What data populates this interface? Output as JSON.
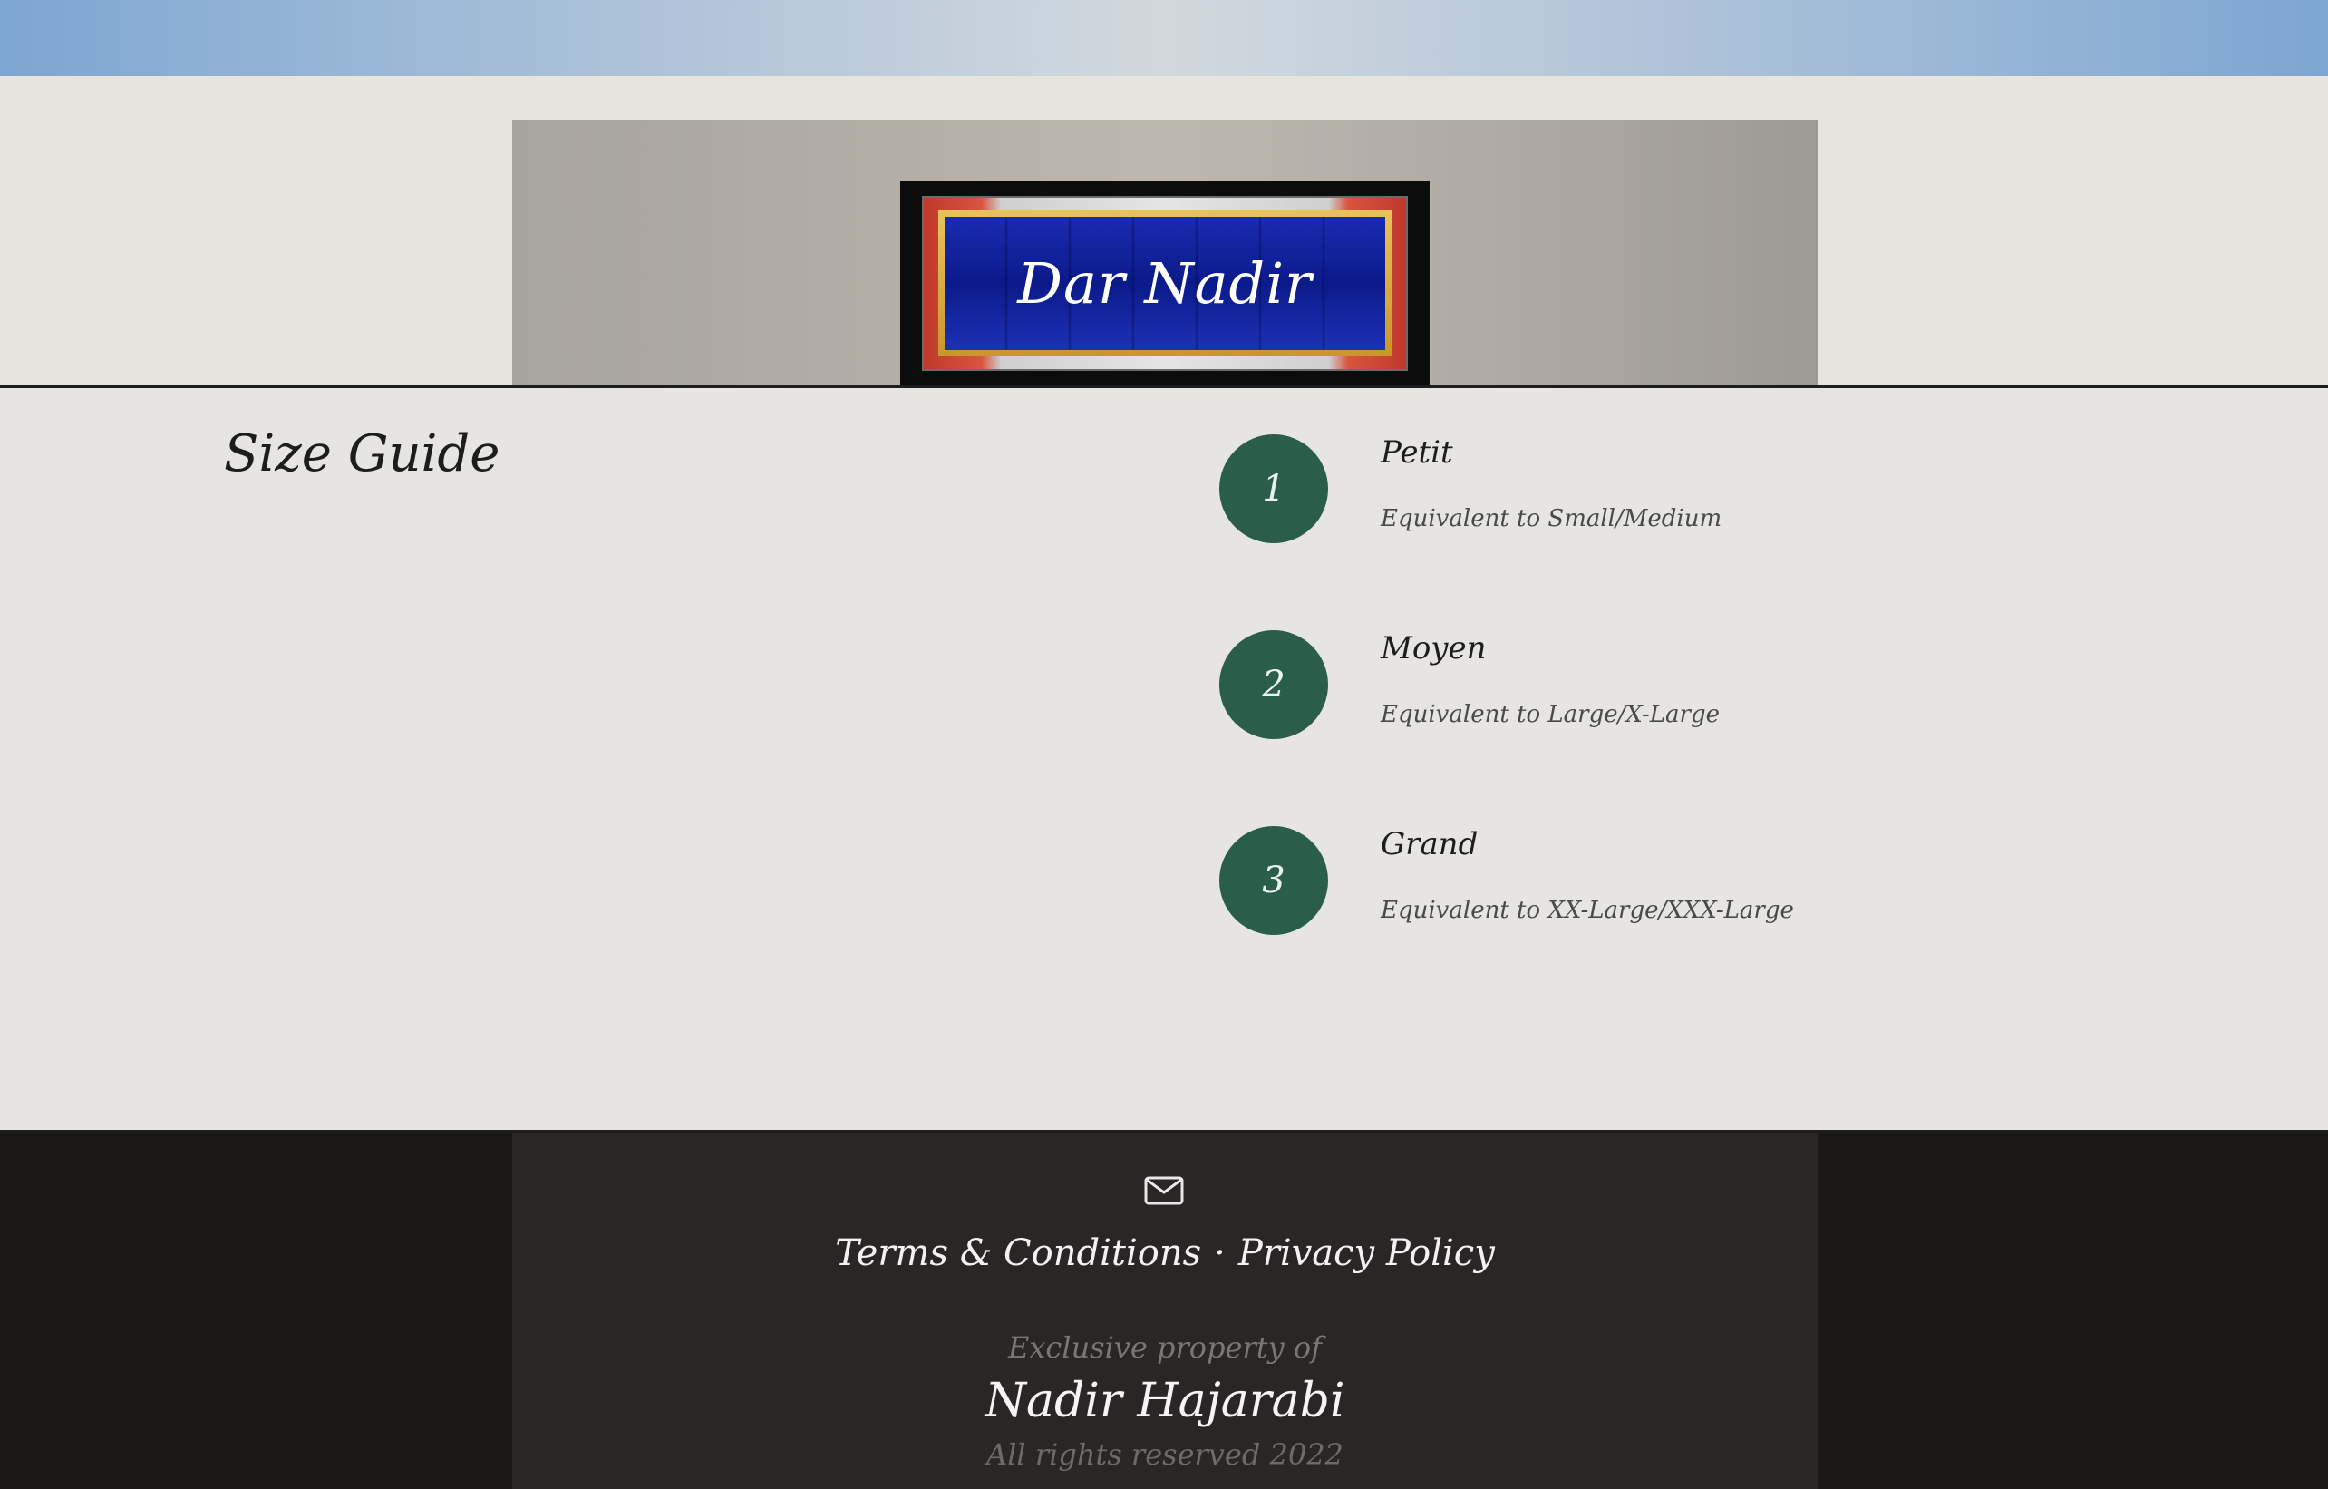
{
  "hero": {
    "sign_text": "Dar Nadir"
  },
  "size_guide": {
    "title": "Size Guide",
    "items": [
      {
        "number": "1",
        "name": "Petit",
        "description": "Equivalent to Small/Medium"
      },
      {
        "number": "2",
        "name": "Moyen",
        "description": "Equivalent to Large/X-Large"
      },
      {
        "number": "3",
        "name": "Grand",
        "description": "Equivalent to XX-Large/XXX-Large"
      }
    ],
    "circle_color": "#2a5e4a"
  },
  "footer": {
    "mail_icon": "mail-icon",
    "terms_label": "Terms & Conditions",
    "separator": "·",
    "privacy_label": "Privacy Policy",
    "owner_prefix": "Exclusive property of",
    "owner_name": "Nadir Hajarabi",
    "rights": "All rights reserved 2022"
  }
}
